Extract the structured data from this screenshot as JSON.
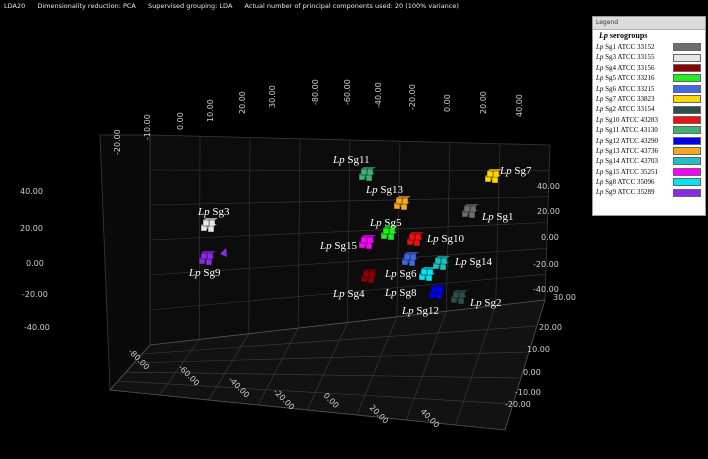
{
  "status_bar": {
    "items": [
      "LDA20",
      "Dimensionality reduction: PCA",
      "Supervised grouping: LDA",
      "Actual number of principal components used: 20 (100% variance)"
    ]
  },
  "legend": {
    "header": "Legend",
    "title_italic": "Lp",
    "title_rest": " serogroups",
    "items": [
      {
        "prefix": "Lp",
        "label": " Sg1 ATCC 33152",
        "color": "#6e6e6e"
      },
      {
        "prefix": "Lp",
        "label": " Sg3 ATCC 33155",
        "color": "#e6e6e6"
      },
      {
        "prefix": "Lp",
        "label": " Sg4 ATCC 33156",
        "color": "#8b0000"
      },
      {
        "prefix": "Lp",
        "label": " Sg5 ATCC 33216",
        "color": "#22ee22"
      },
      {
        "prefix": "Lp",
        "label": " Sg6 ATCC 33215",
        "color": "#4169e1"
      },
      {
        "prefix": "Lp",
        "label": " Sg7 ATCC 33823",
        "color": "#ffd700"
      },
      {
        "prefix": "Lp",
        "label": " Sg2 ATCC 33154",
        "color": "#2f4f4f"
      },
      {
        "prefix": "Lp",
        "label": " Sg10 ATCC 43283",
        "color": "#ee1111"
      },
      {
        "prefix": "Lp",
        "label": " Sg11 ATCC 43130",
        "color": "#3cb371"
      },
      {
        "prefix": "Lp",
        "label": " Sg12 ATCC 43290",
        "color": "#0000ee"
      },
      {
        "prefix": "Lp",
        "label": " Sg13 ATCC 43736",
        "color": "#f5a623"
      },
      {
        "prefix": "Lp",
        "label": " Sg14 ATCC 43703",
        "color": "#20c0c0"
      },
      {
        "prefix": "Lp",
        "label": " Sg15 ATCC 35251",
        "color": "#ff00ff"
      },
      {
        "prefix": "Lp",
        "label": " Sg8 ATCC 35096",
        "color": "#00e5ee"
      },
      {
        "prefix": "Lp",
        "label": " Sg9 ATCC 35289",
        "color": "#8a2be2"
      }
    ]
  },
  "axes": {
    "top_ticks": [
      "-20.00",
      "-10.00",
      "0.00",
      "10.00",
      "20.00",
      "30.00",
      "-80.00",
      "-60.00",
      "-40.00",
      "-20.00",
      "0.00",
      "20.00",
      "40.00"
    ],
    "left_ticks": [
      "40.00",
      "20.00",
      "0.00",
      "-20.00",
      "-40.00"
    ],
    "right_ticks": [
      "40.00",
      "20.00",
      "0.00",
      "-20.00",
      "-40.00"
    ],
    "bottom_ticks": [
      "-80.00",
      "-60.00",
      "-40.00",
      "-20.00",
      "0.00",
      "20.00",
      "40.00"
    ],
    "depth_ticks": [
      "30.00",
      "20.00",
      "10.00",
      "0.00",
      "-10.00",
      "-20.00"
    ]
  },
  "clusters": [
    {
      "prefix": "Lp",
      "label": " Sg11",
      "color": "#3cb371"
    },
    {
      "prefix": "Lp",
      "label": " Sg7",
      "color": "#ffd700"
    },
    {
      "prefix": "Lp",
      "label": " Sg13",
      "color": "#f5a623"
    },
    {
      "prefix": "Lp",
      "label": " Sg1",
      "color": "#6e6e6e"
    },
    {
      "prefix": "Lp",
      "label": " Sg3",
      "color": "#e6e6e6"
    },
    {
      "prefix": "Lp",
      "label": " Sg5",
      "color": "#22ee22"
    },
    {
      "prefix": "Lp",
      "label": " Sg10",
      "color": "#ee1111"
    },
    {
      "prefix": "Lp",
      "label": " Sg15",
      "color": "#ff00ff"
    },
    {
      "prefix": "Lp",
      "label": " Sg9",
      "color": "#8a2be2"
    },
    {
      "prefix": "Lp",
      "label": " Sg14",
      "color": "#20c0c0"
    },
    {
      "prefix": "Lp",
      "label": " Sg6",
      "color": "#4169e1"
    },
    {
      "prefix": "Lp",
      "label": " Sg4",
      "color": "#8b0000"
    },
    {
      "prefix": "Lp",
      "label": " Sg8",
      "color": "#00e5ee"
    },
    {
      "prefix": "Lp",
      "label": " Sg2",
      "color": "#2f4f4f"
    },
    {
      "prefix": "Lp",
      "label": " Sg12",
      "color": "#0000ee"
    }
  ]
}
